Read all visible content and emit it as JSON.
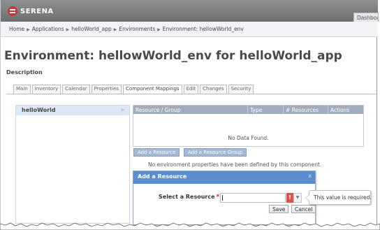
{
  "header": {
    "brand": "SERENA",
    "dashboard_tab": "Dashboard"
  },
  "breadcrumb": [
    "Home",
    "Applications",
    "helloWorld_app",
    "Environments",
    "Environment: hellowWorld_env"
  ],
  "page": {
    "title": "Environment: hellowWorld_env for helloWorld_app",
    "description_label": "Description"
  },
  "tabs": [
    {
      "label": "Main"
    },
    {
      "label": "Inventory"
    },
    {
      "label": "Calendar"
    },
    {
      "label": "Properties"
    },
    {
      "label": "Component Mappings",
      "active": true
    },
    {
      "label": "Edit"
    },
    {
      "label": "Changes"
    },
    {
      "label": "Security"
    }
  ],
  "left_panel": {
    "items": [
      {
        "label": "helloWorld"
      }
    ]
  },
  "grid": {
    "columns": [
      "Resource / Group",
      "Type",
      "# Resources",
      "Actions"
    ],
    "empty_text": "No Data Found."
  },
  "actions": {
    "add_resource": "Add a Resource",
    "add_resource_group": "Add a Resource Group"
  },
  "no_properties_text": "No environment properties have been defined by this component.",
  "dialog": {
    "title": "Add a Resource",
    "close": "x",
    "field_label": "Select a Resource",
    "required_marker": "*",
    "input_value": "",
    "error_marker": "!",
    "save": "Save",
    "cancel": "Cancel"
  },
  "tooltip": {
    "text": "This value is required."
  },
  "colors": {
    "dialog_header": "#5b8ed0",
    "grid_header": "#a1adbd",
    "error": "#d9534f",
    "brand_red": "#c43a32"
  }
}
